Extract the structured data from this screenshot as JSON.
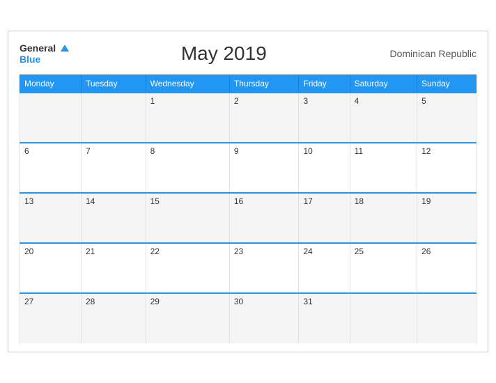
{
  "header": {
    "logo_general": "General",
    "logo_blue": "Blue",
    "title": "May 2019",
    "region": "Dominican Republic"
  },
  "weekdays": [
    "Monday",
    "Tuesday",
    "Wednesday",
    "Thursday",
    "Friday",
    "Saturday",
    "Sunday"
  ],
  "weeks": [
    [
      "",
      "",
      "1",
      "2",
      "3",
      "4",
      "5"
    ],
    [
      "6",
      "7",
      "8",
      "9",
      "10",
      "11",
      "12"
    ],
    [
      "13",
      "14",
      "15",
      "16",
      "17",
      "18",
      "19"
    ],
    [
      "20",
      "21",
      "22",
      "23",
      "24",
      "25",
      "26"
    ],
    [
      "27",
      "28",
      "29",
      "30",
      "31",
      "",
      ""
    ]
  ]
}
